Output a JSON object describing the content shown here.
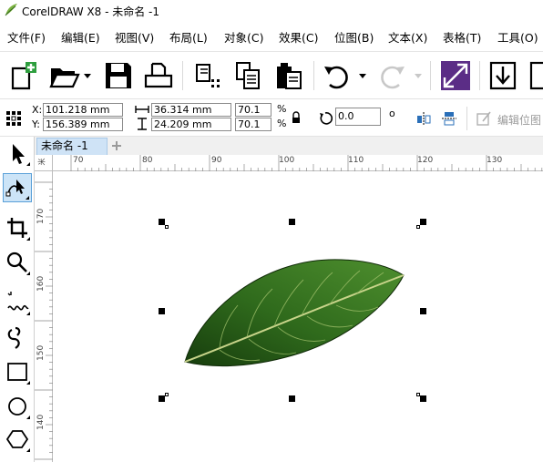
{
  "window": {
    "title": "CorelDRAW X8 - 未命名 -1"
  },
  "menu": {
    "items": [
      "文件(F)",
      "编辑(E)",
      "视图(V)",
      "布局(L)",
      "对象(C)",
      "效果(C)",
      "位图(B)",
      "文本(X)",
      "表格(T)",
      "工具(O)"
    ]
  },
  "toolbar": {
    "buttons": [
      "new-document-icon",
      "open-folder-icon",
      "save-icon",
      "print-icon",
      "cut-icon",
      "copy-icon",
      "paste-icon",
      "undo-icon",
      "redo-icon",
      "import-icon",
      "export-icon"
    ]
  },
  "propbar": {
    "x_label": "X:",
    "x_value": "101.218 mm",
    "y_label": "Y:",
    "y_value": "156.389 mm",
    "width_value": "36.314 mm",
    "height_value": "24.209 mm",
    "scale_x": "70.1",
    "scale_y": "70.1",
    "percent_sign": "%",
    "rotation_value": "0.0",
    "degree_sign": "o",
    "edit_bitmap_label": "编辑位图"
  },
  "document": {
    "tab_label": "未命名 -1"
  },
  "ruler": {
    "h_labels": [
      "70",
      "80",
      "90",
      "100",
      "110",
      "120",
      "130"
    ],
    "v_labels": [
      "170",
      "160",
      "150",
      "140"
    ],
    "corner_label": "米"
  },
  "colors": {
    "accent": "#5b2d86",
    "leaf_dark": "#1e4d12",
    "leaf_mid": "#3f7a25",
    "selection": "#000000"
  }
}
